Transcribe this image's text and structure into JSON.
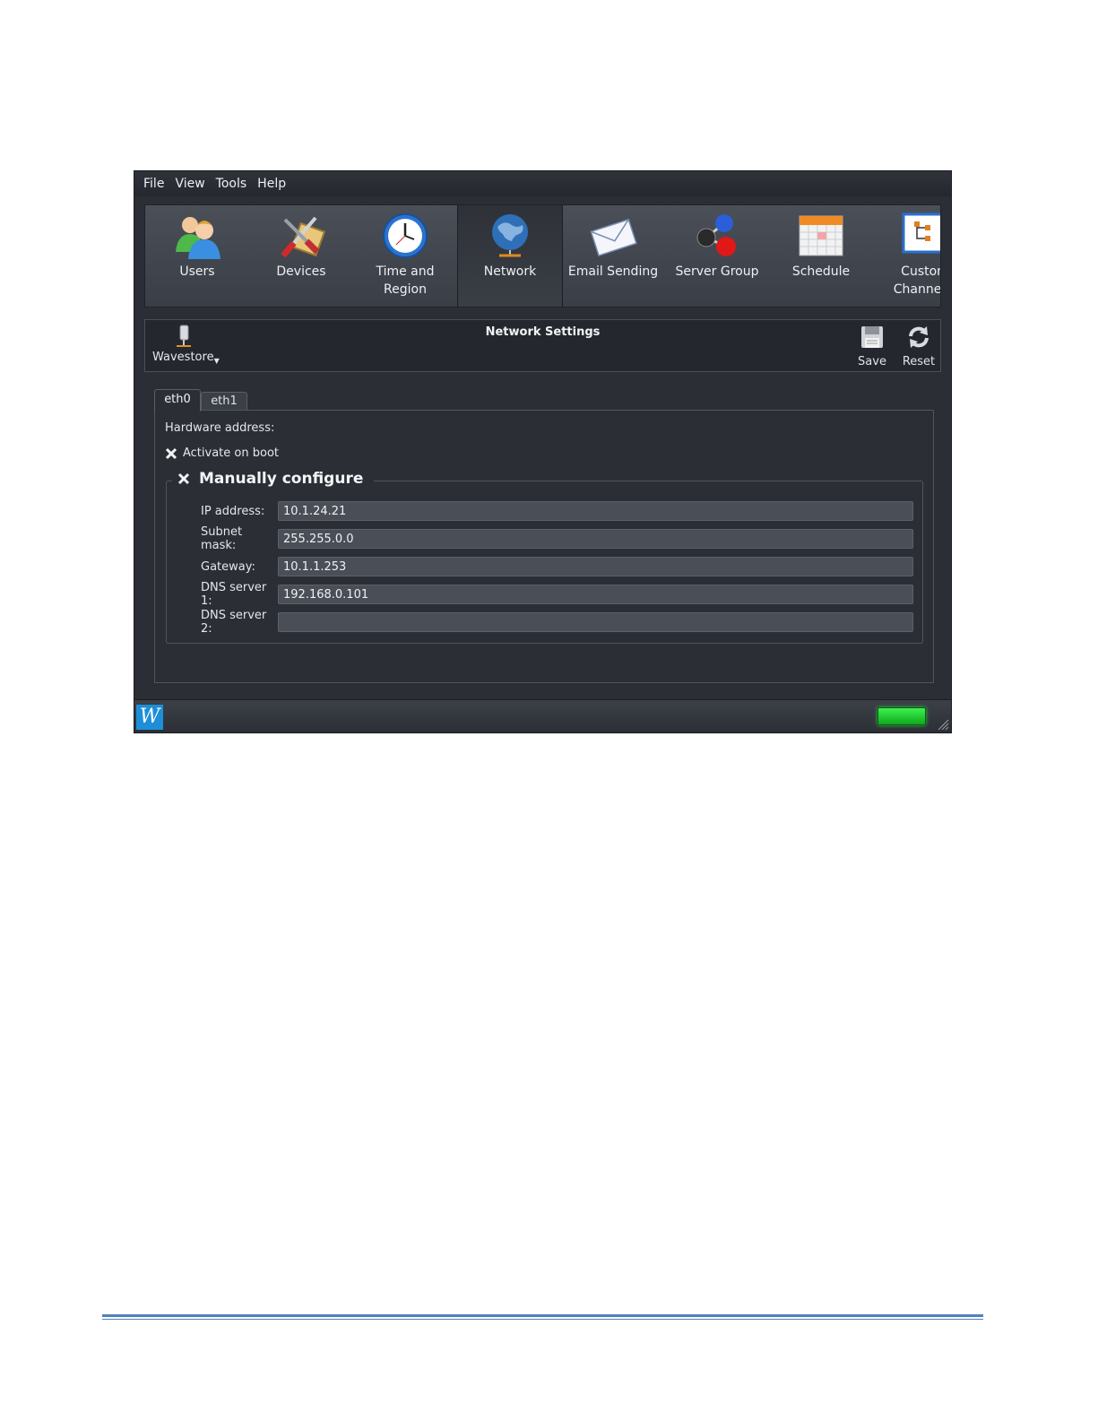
{
  "menu": [
    "File",
    "View",
    "Tools",
    "Help"
  ],
  "ribbon": {
    "items": [
      {
        "label": "Users",
        "icon": "users-icon"
      },
      {
        "label": "Devices",
        "icon": "devices-icon"
      },
      {
        "label": "Time and\nRegion",
        "icon": "clock-icon"
      },
      {
        "label": "Network",
        "icon": "globe-icon"
      },
      {
        "label": "Email Sending",
        "icon": "envelope-icon"
      },
      {
        "label": "Server Group",
        "icon": "server-group-icon"
      },
      {
        "label": "Schedule",
        "icon": "calendar-icon"
      },
      {
        "label": "Custom\nChannel T",
        "icon": "custom-channel-icon"
      }
    ],
    "active": "Network"
  },
  "toolbar": {
    "title": "Network Settings",
    "server_label": "Wavestore",
    "save_label": "Save",
    "reset_label": "Reset"
  },
  "tabs": [
    {
      "label": "eth0",
      "active": true
    },
    {
      "label": "eth1",
      "active": false
    }
  ],
  "form": {
    "hardware_label": "Hardware address:",
    "activate_label": "Activate on boot",
    "manual_label": "Manually configure",
    "fields": [
      {
        "label": "IP address:",
        "value": "10.1.24.21"
      },
      {
        "label": "Subnet mask:",
        "value": "255.255.0.0"
      },
      {
        "label": "Gateway:",
        "value": "10.1.1.253"
      },
      {
        "label": "DNS server 1:",
        "value": "192.168.0.101"
      },
      {
        "label": "DNS server 2:",
        "value": ""
      }
    ]
  },
  "status": {
    "logo_letter": "W",
    "led_color": "#22d634"
  }
}
